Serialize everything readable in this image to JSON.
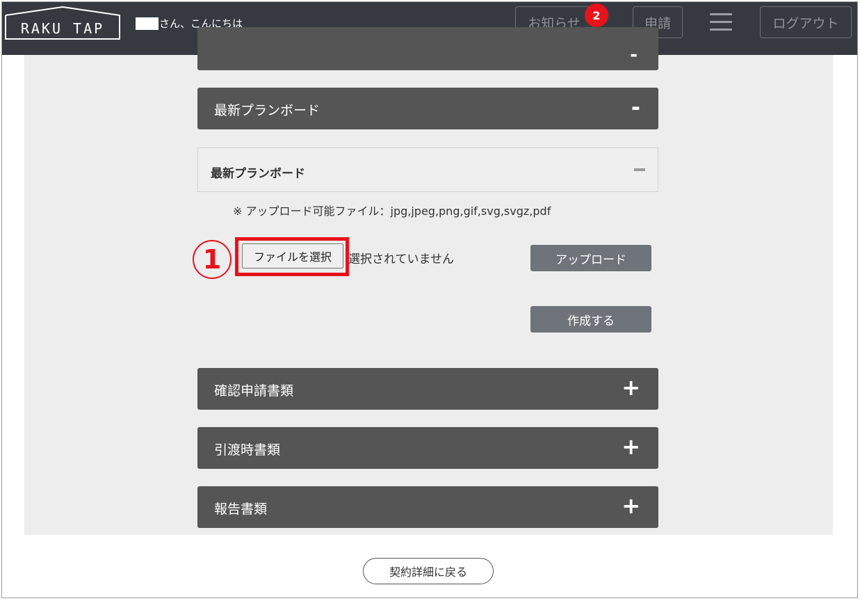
{
  "header": {
    "logo_text": "RAKU TAP",
    "greeting": "さん、こんにちは",
    "notice_label": "お知らせ",
    "notice_count": "2",
    "apply_label": "申請",
    "logout_label": "ログアウト"
  },
  "panels": {
    "latest_plan_board": {
      "title": "最新プランボード",
      "sign": "-"
    },
    "confirmation_docs": {
      "title": "確認申請書類",
      "sign": "+"
    },
    "handover_docs": {
      "title": "引渡時書類",
      "sign": "+"
    },
    "report_docs": {
      "title": "報告書類",
      "sign": "+"
    }
  },
  "subpanel": {
    "title": "最新プランボード",
    "note": "※ アップロード可能ファイル：jpg,jpeg,png,gif,svg,svgz,pdf"
  },
  "upload": {
    "choose_file_label": "ファイルを選択",
    "file_status": "選択されていません",
    "upload_label": "アップロード",
    "create_label": "作成する"
  },
  "annotation": {
    "step_number": "1"
  },
  "footer": {
    "back_label": "契約詳細に戻る"
  },
  "colors": {
    "header_bg": "#363a40",
    "panel_bg": "#555555",
    "button_gray": "#6f737a",
    "highlight_red": "#e8121b",
    "content_bg": "#ededed"
  }
}
